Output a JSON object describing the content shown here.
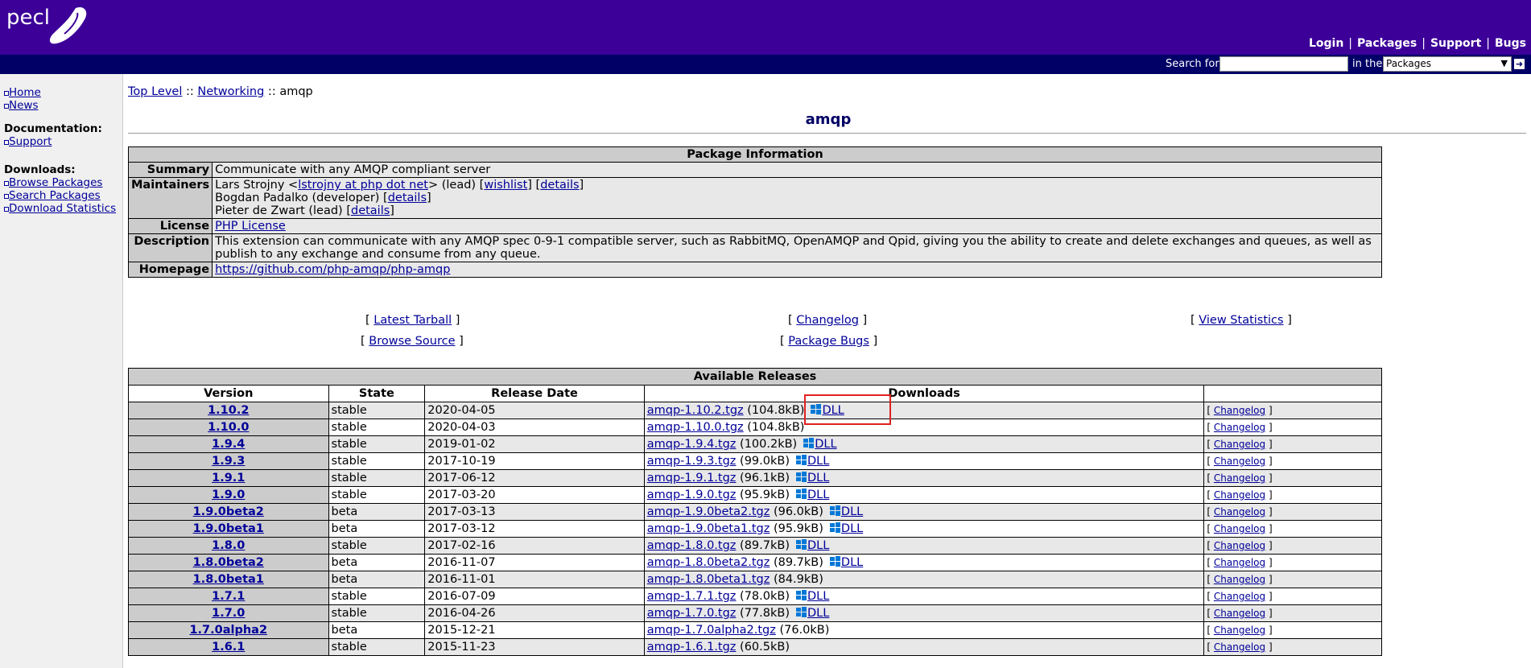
{
  "header": {
    "logo_text": "pecl",
    "nav": [
      "Login",
      "Packages",
      "Support",
      "Bugs"
    ],
    "search_label": "Search for",
    "search_value": "",
    "in_the_label": "in the",
    "search_scope": "Packages",
    "colors": {
      "header_bg": "#3c0099",
      "search_bar_bg": "#000066"
    }
  },
  "sidebar": {
    "nav1": [
      "Home",
      "News"
    ],
    "doc_heading": "Documentation:",
    "doc_items": [
      "Support"
    ],
    "downloads_heading": "Downloads:",
    "download_items": [
      "Browse Packages",
      "Search Packages",
      "Download Statistics"
    ]
  },
  "breadcrumb": {
    "top": "Top Level",
    "sep1": " :: ",
    "cat": "Networking",
    "sep2": " :: ",
    "current": "amqp"
  },
  "title": "amqp",
  "package_info": {
    "caption": "Package Information",
    "summary_label": "Summary",
    "summary": "Communicate with any AMQP compliant server",
    "maintainers_label": "Maintainers",
    "m1_name": "Lars Strojny <",
    "m1_email": "lstrojny at php dot net",
    "m1_role": "> (lead) [",
    "m1_wishlist": "wishlist",
    "m1_mid": "] [",
    "details": "details",
    "close": "]",
    "m2_name": "Bogdan Padalko (developer) [",
    "m3_name": "Pieter de Zwart (lead) [",
    "license_label": "License",
    "license": "PHP License",
    "description_label": "Description",
    "description": "This extension can communicate with any AMQP spec 0-9-1 compatible server, such as RabbitMQ, OpenAMQP and Qpid, giving you the ability to create and delete exchanges and queues, as well as publish to any exchange and consume from any queue.",
    "homepage_label": "Homepage",
    "homepage": "https://github.com/php-amqp/php-amqp"
  },
  "links": {
    "latest_tarball": "Latest Tarball",
    "changelog": "Changelog",
    "view_statistics": "View Statistics",
    "browse_source": "Browse Source",
    "package_bugs": "Package Bugs"
  },
  "releases": {
    "caption": "Available Releases",
    "headers": [
      "Version",
      "State",
      "Release Date",
      "Downloads",
      ""
    ],
    "changelog_label": "Changelog",
    "dll_label": "DLL",
    "rows": [
      {
        "version": "1.10.2",
        "state": "stable",
        "date": "2020-04-05",
        "file": "amqp-1.10.2.tgz",
        "size": "(104.8kB)",
        "dll": true
      },
      {
        "version": "1.10.0",
        "state": "stable",
        "date": "2020-04-03",
        "file": "amqp-1.10.0.tgz",
        "size": "(104.8kB)",
        "dll": false
      },
      {
        "version": "1.9.4",
        "state": "stable",
        "date": "2019-01-02",
        "file": "amqp-1.9.4.tgz",
        "size": "(100.2kB)",
        "dll": true
      },
      {
        "version": "1.9.3",
        "state": "stable",
        "date": "2017-10-19",
        "file": "amqp-1.9.3.tgz",
        "size": "(99.0kB)",
        "dll": true
      },
      {
        "version": "1.9.1",
        "state": "stable",
        "date": "2017-06-12",
        "file": "amqp-1.9.1.tgz",
        "size": "(96.1kB)",
        "dll": true
      },
      {
        "version": "1.9.0",
        "state": "stable",
        "date": "2017-03-20",
        "file": "amqp-1.9.0.tgz",
        "size": "(95.9kB)",
        "dll": true
      },
      {
        "version": "1.9.0beta2",
        "state": "beta",
        "date": "2017-03-13",
        "file": "amqp-1.9.0beta2.tgz",
        "size": "(96.0kB)",
        "dll": true
      },
      {
        "version": "1.9.0beta1",
        "state": "beta",
        "date": "2017-03-12",
        "file": "amqp-1.9.0beta1.tgz",
        "size": "(95.9kB)",
        "dll": true
      },
      {
        "version": "1.8.0",
        "state": "stable",
        "date": "2017-02-16",
        "file": "amqp-1.8.0.tgz",
        "size": "(89.7kB)",
        "dll": true
      },
      {
        "version": "1.8.0beta2",
        "state": "beta",
        "date": "2016-11-07",
        "file": "amqp-1.8.0beta2.tgz",
        "size": "(89.7kB)",
        "dll": true
      },
      {
        "version": "1.8.0beta1",
        "state": "beta",
        "date": "2016-11-01",
        "file": "amqp-1.8.0beta1.tgz",
        "size": "(84.9kB)",
        "dll": false
      },
      {
        "version": "1.7.1",
        "state": "stable",
        "date": "2016-07-09",
        "file": "amqp-1.7.1.tgz",
        "size": "(78.0kB)",
        "dll": true
      },
      {
        "version": "1.7.0",
        "state": "stable",
        "date": "2016-04-26",
        "file": "amqp-1.7.0.tgz",
        "size": "(77.8kB)",
        "dll": true
      },
      {
        "version": "1.7.0alpha2",
        "state": "beta",
        "date": "2015-12-21",
        "file": "amqp-1.7.0alpha2.tgz",
        "size": "(76.0kB)",
        "dll": false
      },
      {
        "version": "1.6.1",
        "state": "stable",
        "date": "2015-11-23",
        "file": "amqp-1.6.1.tgz",
        "size": "(60.5kB)",
        "dll": false
      }
    ]
  },
  "highlight_color": "#e02020"
}
